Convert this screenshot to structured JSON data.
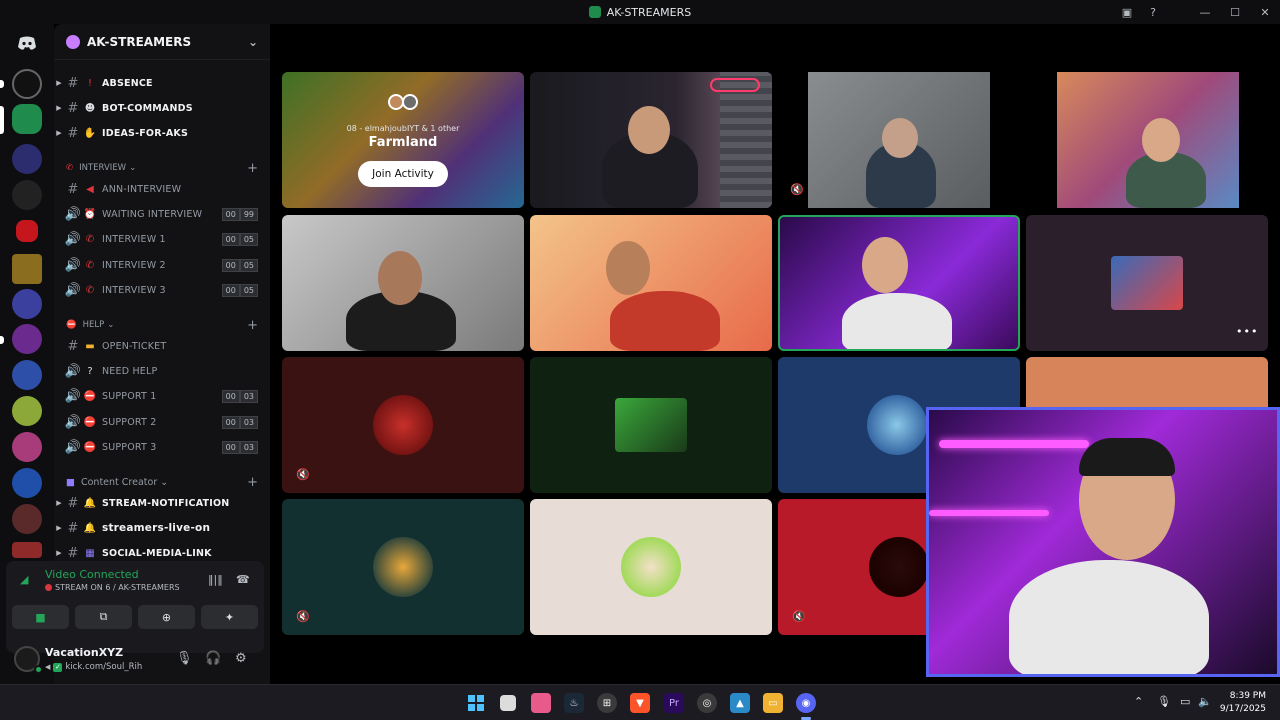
{
  "window": {
    "title": "AK-STREAMERS"
  },
  "guild": {
    "name": "AK-STREAMERS"
  },
  "channels": [
    {
      "type": "text",
      "name": "ABSENCE",
      "icon": "exclamation-icon",
      "bold": true,
      "thread": true
    },
    {
      "type": "text",
      "name": "BOT-COMMANDS",
      "icon": "robot-icon",
      "bold": true,
      "thread": true
    },
    {
      "type": "text",
      "name": "IDEAS-FOR-AKS",
      "icon": "hand-icon",
      "bold": true,
      "thread": true
    }
  ],
  "categories": {
    "interview": {
      "label": "INTERVIEW",
      "channels": [
        {
          "type": "text",
          "name": "ANN-INTERVIEW",
          "icon": "megaphone-icon"
        },
        {
          "type": "voice",
          "name": "WAITING INTERVIEW",
          "icon": "alarm-icon",
          "count_a": "00",
          "count_b": "99"
        },
        {
          "type": "voice",
          "name": "INTERVIEW 1",
          "icon": "phone-icon",
          "count_a": "00",
          "count_b": "05"
        },
        {
          "type": "voice",
          "name": "INTERVIEW 2",
          "icon": "phone-icon",
          "count_a": "00",
          "count_b": "05"
        },
        {
          "type": "voice",
          "name": "INTERVIEW 3",
          "icon": "phone-icon",
          "count_a": "00",
          "count_b": "05"
        }
      ]
    },
    "help": {
      "label": "HELP",
      "channels": [
        {
          "type": "text",
          "name": "OPEN-TICKET",
          "icon": "ticket-icon"
        },
        {
          "type": "voice",
          "name": "NEED HELP",
          "icon": "question-icon"
        },
        {
          "type": "voice",
          "name": "SUPPORT 1",
          "icon": "no-entry-icon",
          "count_a": "00",
          "count_b": "03"
        },
        {
          "type": "voice",
          "name": "SUPPORT 2",
          "icon": "no-entry-icon",
          "count_a": "00",
          "count_b": "03"
        },
        {
          "type": "voice",
          "name": "SUPPORT 3",
          "icon": "no-entry-icon",
          "count_a": "00",
          "count_b": "03"
        }
      ]
    },
    "creator": {
      "label": "Content Creator",
      "channels": [
        {
          "type": "text",
          "name": "STREAM-NOTIFICATION",
          "icon": "bell-icon"
        },
        {
          "type": "text",
          "name": "streamers-live-on",
          "icon": "bell-icon"
        },
        {
          "type": "text",
          "name": "SOCIAL-MEDIA-LINK",
          "icon": "clapper-icon"
        }
      ]
    }
  },
  "voice": {
    "status": "Video Connected",
    "channel": "STREAM ON 6 / AK-STREAMERS"
  },
  "user": {
    "name": "VacationXYZ",
    "custom_status": "kick.com/Soul_Rih"
  },
  "activity": {
    "participants": "08 - elmahjoubIYT & 1 other",
    "title": "Farmland",
    "join_label": "Join Activity"
  },
  "taskbar": {
    "time": "8:39 PM",
    "date": "9/17/2025"
  },
  "colors": {
    "accent": "#5865f2",
    "connected": "#23a55a",
    "danger": "#da373c"
  }
}
